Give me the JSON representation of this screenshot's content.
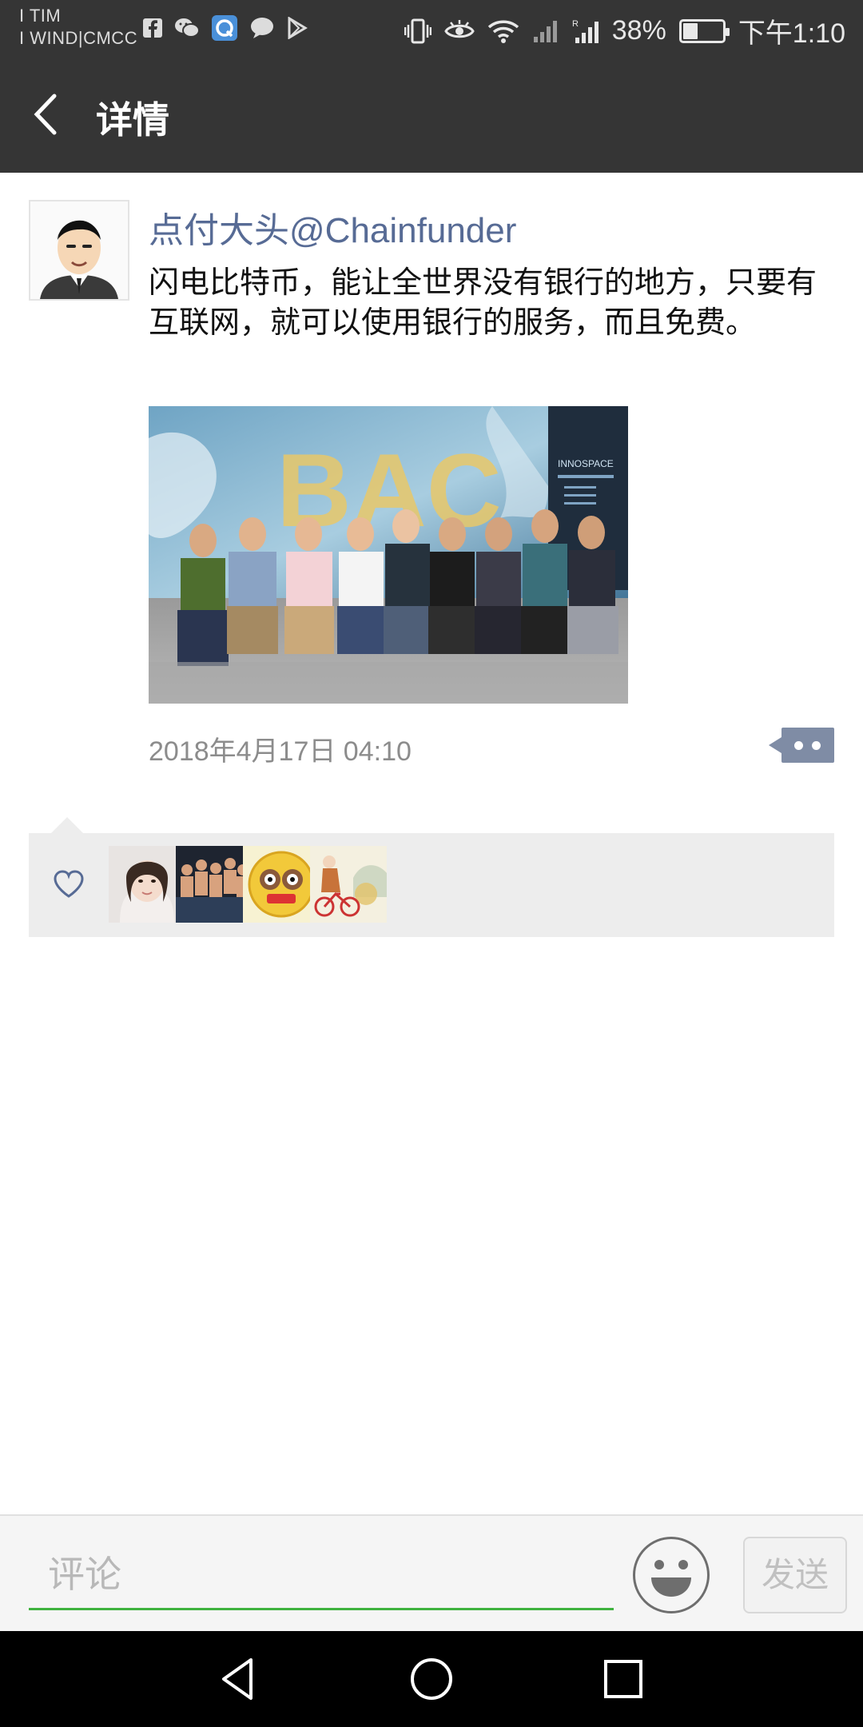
{
  "status_bar": {
    "carrier_line1": "I TIM",
    "carrier_line2": "I WIND|CMCC",
    "battery_percent": "38%",
    "battery_level": 0.38,
    "time": "下午1:10",
    "icons": [
      "facebook-icon",
      "wechat-icon",
      "qq-browser-icon",
      "message-icon",
      "play-store-icon",
      "vibrate-icon",
      "eye-icon",
      "wifi-icon",
      "signal-icon",
      "signal-roaming-icon",
      "battery-icon"
    ]
  },
  "header": {
    "title": "详情"
  },
  "post": {
    "author": "点付大头@Chainfunder",
    "text": "闪电比特币，能让全世界没有银行的地方，只要有互联网，就可以使用银行的服务，而且免费。",
    "timestamp": "2018年4月17日 04:10",
    "image_signage": "INNOSPACE"
  },
  "likes": {
    "icon": "heart-icon",
    "count": 4
  },
  "comment_bar": {
    "placeholder": "评论",
    "send_label": "发送"
  },
  "colors": {
    "header_bg": "#353535",
    "author_link": "#576b95",
    "accent_green": "#3fb23f",
    "likes_bg": "#ededed"
  }
}
